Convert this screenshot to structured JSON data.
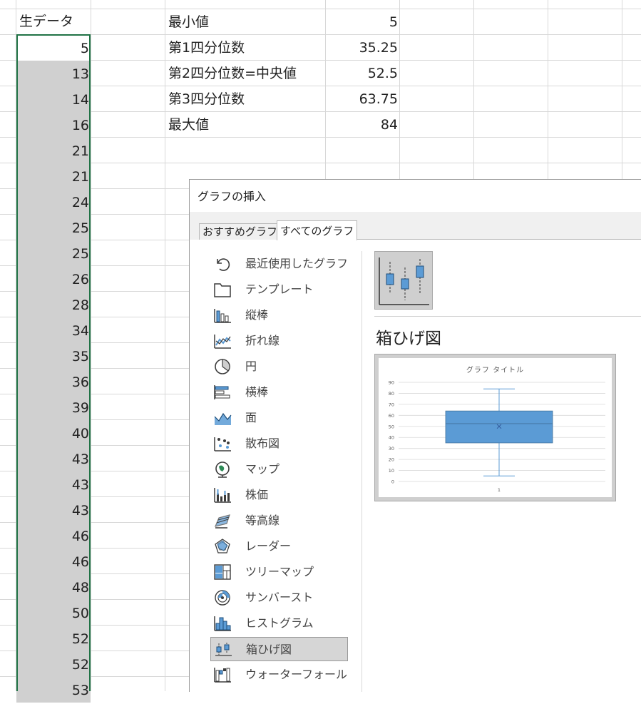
{
  "sheet": {
    "header": "生データ",
    "values": [
      5,
      13,
      14,
      16,
      21,
      21,
      24,
      25,
      25,
      26,
      28,
      34,
      35,
      36,
      39,
      40,
      43,
      43,
      43,
      46,
      46,
      48,
      50,
      52,
      52,
      53
    ],
    "stats": [
      {
        "label": "最小値",
        "value": "5"
      },
      {
        "label": "第1四分位数",
        "value": "35.25"
      },
      {
        "label": "第2四分位数=中央値",
        "value": "52.5"
      },
      {
        "label": "第3四分位数",
        "value": "63.75"
      },
      {
        "label": "最大値",
        "value": "84"
      }
    ],
    "selection_color": "#217346"
  },
  "dialog": {
    "title": "グラフの挿入",
    "tabs": [
      {
        "label": "おすすめグラフ",
        "active": false
      },
      {
        "label": "すべてのグラフ",
        "active": true
      }
    ],
    "categories": [
      {
        "label": "最近使用したグラフ",
        "icon": "recent-icon"
      },
      {
        "label": "テンプレート",
        "icon": "template-folder-icon"
      },
      {
        "label": "縦棒",
        "icon": "column-chart-icon"
      },
      {
        "label": "折れ線",
        "icon": "line-chart-icon"
      },
      {
        "label": "円",
        "icon": "pie-chart-icon"
      },
      {
        "label": "横棒",
        "icon": "bar-chart-icon"
      },
      {
        "label": "面",
        "icon": "area-chart-icon"
      },
      {
        "label": "散布図",
        "icon": "scatter-chart-icon"
      },
      {
        "label": "マップ",
        "icon": "map-globe-icon"
      },
      {
        "label": "株価",
        "icon": "stock-chart-icon"
      },
      {
        "label": "等高線",
        "icon": "surface-chart-icon"
      },
      {
        "label": "レーダー",
        "icon": "radar-chart-icon"
      },
      {
        "label": "ツリーマップ",
        "icon": "treemap-icon"
      },
      {
        "label": "サンバースト",
        "icon": "sunburst-icon"
      },
      {
        "label": "ヒストグラム",
        "icon": "histogram-icon"
      },
      {
        "label": "箱ひげ図",
        "icon": "box-whisker-icon",
        "selected": true
      },
      {
        "label": "ウォーターフォール",
        "icon": "waterfall-icon"
      }
    ],
    "selected_chart_name": "箱ひげ図",
    "accent_color": "#5b9bd5"
  },
  "chart_data": {
    "type": "box",
    "title": "グラフ タイトル",
    "categories": [
      "1"
    ],
    "yticks": [
      0,
      10,
      20,
      30,
      40,
      50,
      60,
      70,
      80,
      90
    ],
    "ylim": [
      0,
      90
    ],
    "box": {
      "min": 5,
      "q1": 35,
      "median": 52.5,
      "q3": 64,
      "max": 84,
      "mean": 50
    },
    "grid": true,
    "color": "#5b9bd5"
  }
}
